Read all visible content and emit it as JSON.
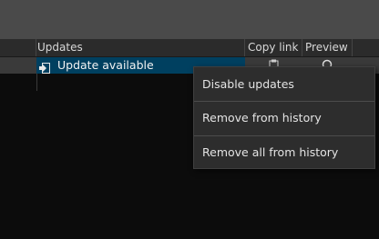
{
  "table": {
    "columns": {
      "updates": "Updates",
      "copy_link": "Copy link",
      "preview": "Preview"
    },
    "rows": [
      {
        "label": "Update available",
        "icon": "update-available-icon",
        "copy_icon": "clipboard-icon",
        "preview_icon": "magnifier-icon"
      }
    ]
  },
  "context_menu": {
    "items": [
      "Disable updates",
      "Remove from history",
      "Remove all from history"
    ]
  },
  "colors": {
    "selection": "#004060",
    "row_background": "#3a3a3a",
    "background": "#0c0c0c",
    "toolbar": "#4a4a4a",
    "header": "#2b2b2b",
    "menu_background": "#2d2d2d"
  }
}
